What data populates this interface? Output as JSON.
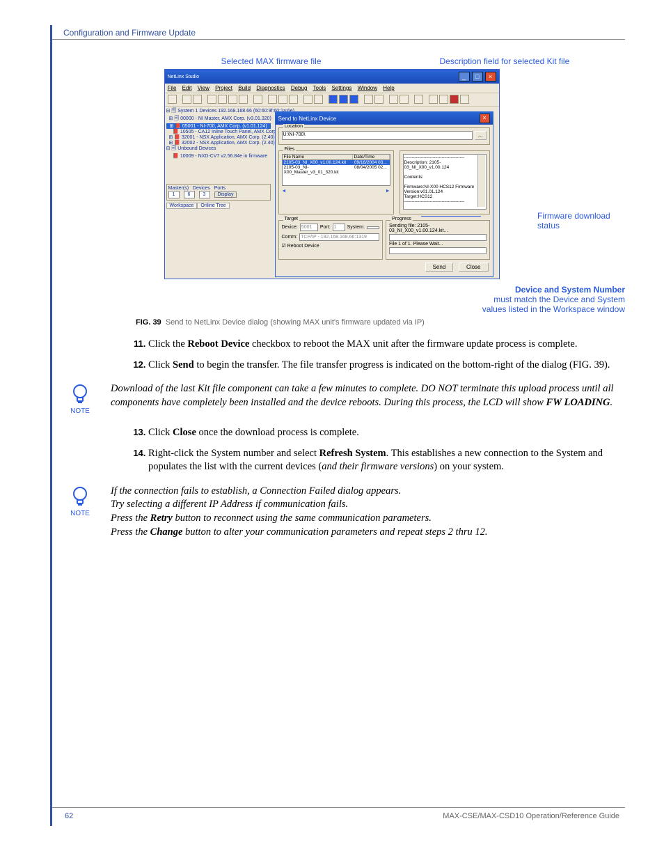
{
  "header": "Configuration and Firmware Update",
  "callouts": {
    "top_left": "Selected MAX firmware file",
    "top_right": "Description field for selected Kit file",
    "side": "Firmware download status",
    "bottom_bold": "Device and System Number",
    "bottom_l1": "must match the Device and System",
    "bottom_l2": "values listed in the Workspace window"
  },
  "app": {
    "title": "NetLinx Studio",
    "menus": [
      "File",
      "Edit",
      "View",
      "Project",
      "Build",
      "Diagnostics",
      "Debug",
      "Tools",
      "Settings",
      "Window",
      "Help"
    ]
  },
  "tree": {
    "root": "System 1 Devices 192.168.168.66 (60:60:9f:60:1a:6e)",
    "items": [
      "00000 - NI Master, AMX Corp. (v3.01.320)",
      "05001 - NI-700, AMX Corp. (v1.01.124)",
      "10505 - CA12 Inline Touch Panel, AMX Corp.",
      "32001 - NSX Application, AMX Corp. (2.40)",
      "32002 - NSX Application, AMX Corp. (2.40)"
    ],
    "unbound_header": "Unbound Devices",
    "unbound_item": "10009 - NXD-CV7 v2.56.84e in firmware",
    "masters": "Master(s)",
    "devices": "Devices",
    "ports": "Ports",
    "m": "1",
    "d": "6",
    "p": "3",
    "display": "Display",
    "tab1": "Workspace",
    "tab2": "Online Tree"
  },
  "dialog": {
    "title": "Send to NetLinx Device",
    "location_group": "Location",
    "location_value": "U:\\NI-700\\",
    "browse": "...",
    "files_group": "Files",
    "col_file": "File Name",
    "col_date": "Date/Time",
    "row1_file": "2105-03_NI_X00_v1.00.124.kit",
    "row1_date": "09/16/2004  03...",
    "row2_file": "2105-03_NI-X00_Master_v3_01_320.kit",
    "row2_date": "08/04/2005  02...",
    "desc_label": "Description:",
    "desc_val": "2105-03_NI_X00_v1.00.124",
    "contents_label": "Contents:",
    "desc_body1": "Firmware:NI-X00 HCS12 Firmware",
    "desc_body2": "Version:v01.01.124",
    "desc_body3": "Target:HCS12",
    "target_group": "Target",
    "device_lbl": "Device:",
    "device_val": "5001",
    "port_lbl": "Port:",
    "port_val": "1",
    "system_lbl": "System:",
    "system_val": "",
    "comm_lbl": "Comm:",
    "comm_val": "TCP/IP - 192.168.168.66:1319",
    "reboot": "Reboot Device",
    "progress_group": "Progress",
    "progress1": "Sending file: 2105-03_NI_X00_v1.00.124.kit...",
    "progress2": "File 1 of 1. Please Wait...",
    "send": "Send",
    "close": "Close"
  },
  "figcaption": {
    "no": "FIG. 39",
    "txt": "Send to NetLinx Device dialog (showing MAX unit's firmware updated via IP)"
  },
  "steps": {
    "s11a": "Click the ",
    "s11b": "Reboot Device",
    "s11c": " checkbox to reboot the MAX unit after the firmware update process is complete.",
    "s12a": "Click ",
    "s12b": "Send",
    "s12c": " to begin the transfer. The file transfer progress is indicated on the bottom-right of the dialog (FIG. 39).",
    "s13a": "Click ",
    "s13b": "Close",
    "s13c": " once the download process is complete.",
    "s14a": "Right-click the System number and select ",
    "s14b": "Refresh System",
    "s14c": ". This establishes a new connection to the System and populates the list with the current devices (",
    "s14d": "and their firmware versions",
    "s14e": ") on your system."
  },
  "notes": {
    "label": "NOTE",
    "n1a": "Download of the last Kit file component can take a few minutes to complete. DO NOT terminate this upload process until all components have completely been installed and the device reboots. During this process, the LCD will show ",
    "n1b": "FW LOADING",
    "n1c": ".",
    "n2_l1": "If the connection fails to establish, a Connection Failed dialog appears.",
    "n2_l2": "Try selecting a different IP Address if communication fails.",
    "n2_l3a": "Press the ",
    "n2_l3b": "Retry",
    "n2_l3c": " button to reconnect using the same communication parameters.",
    "n2_l4a": "Press the ",
    "n2_l4b": "Change",
    "n2_l4c": " button to alter your communication parameters and repeat steps 2 thru 12."
  },
  "footer": {
    "page": "62",
    "doc": "MAX-CSE/MAX-CSD10 Operation/Reference Guide"
  }
}
